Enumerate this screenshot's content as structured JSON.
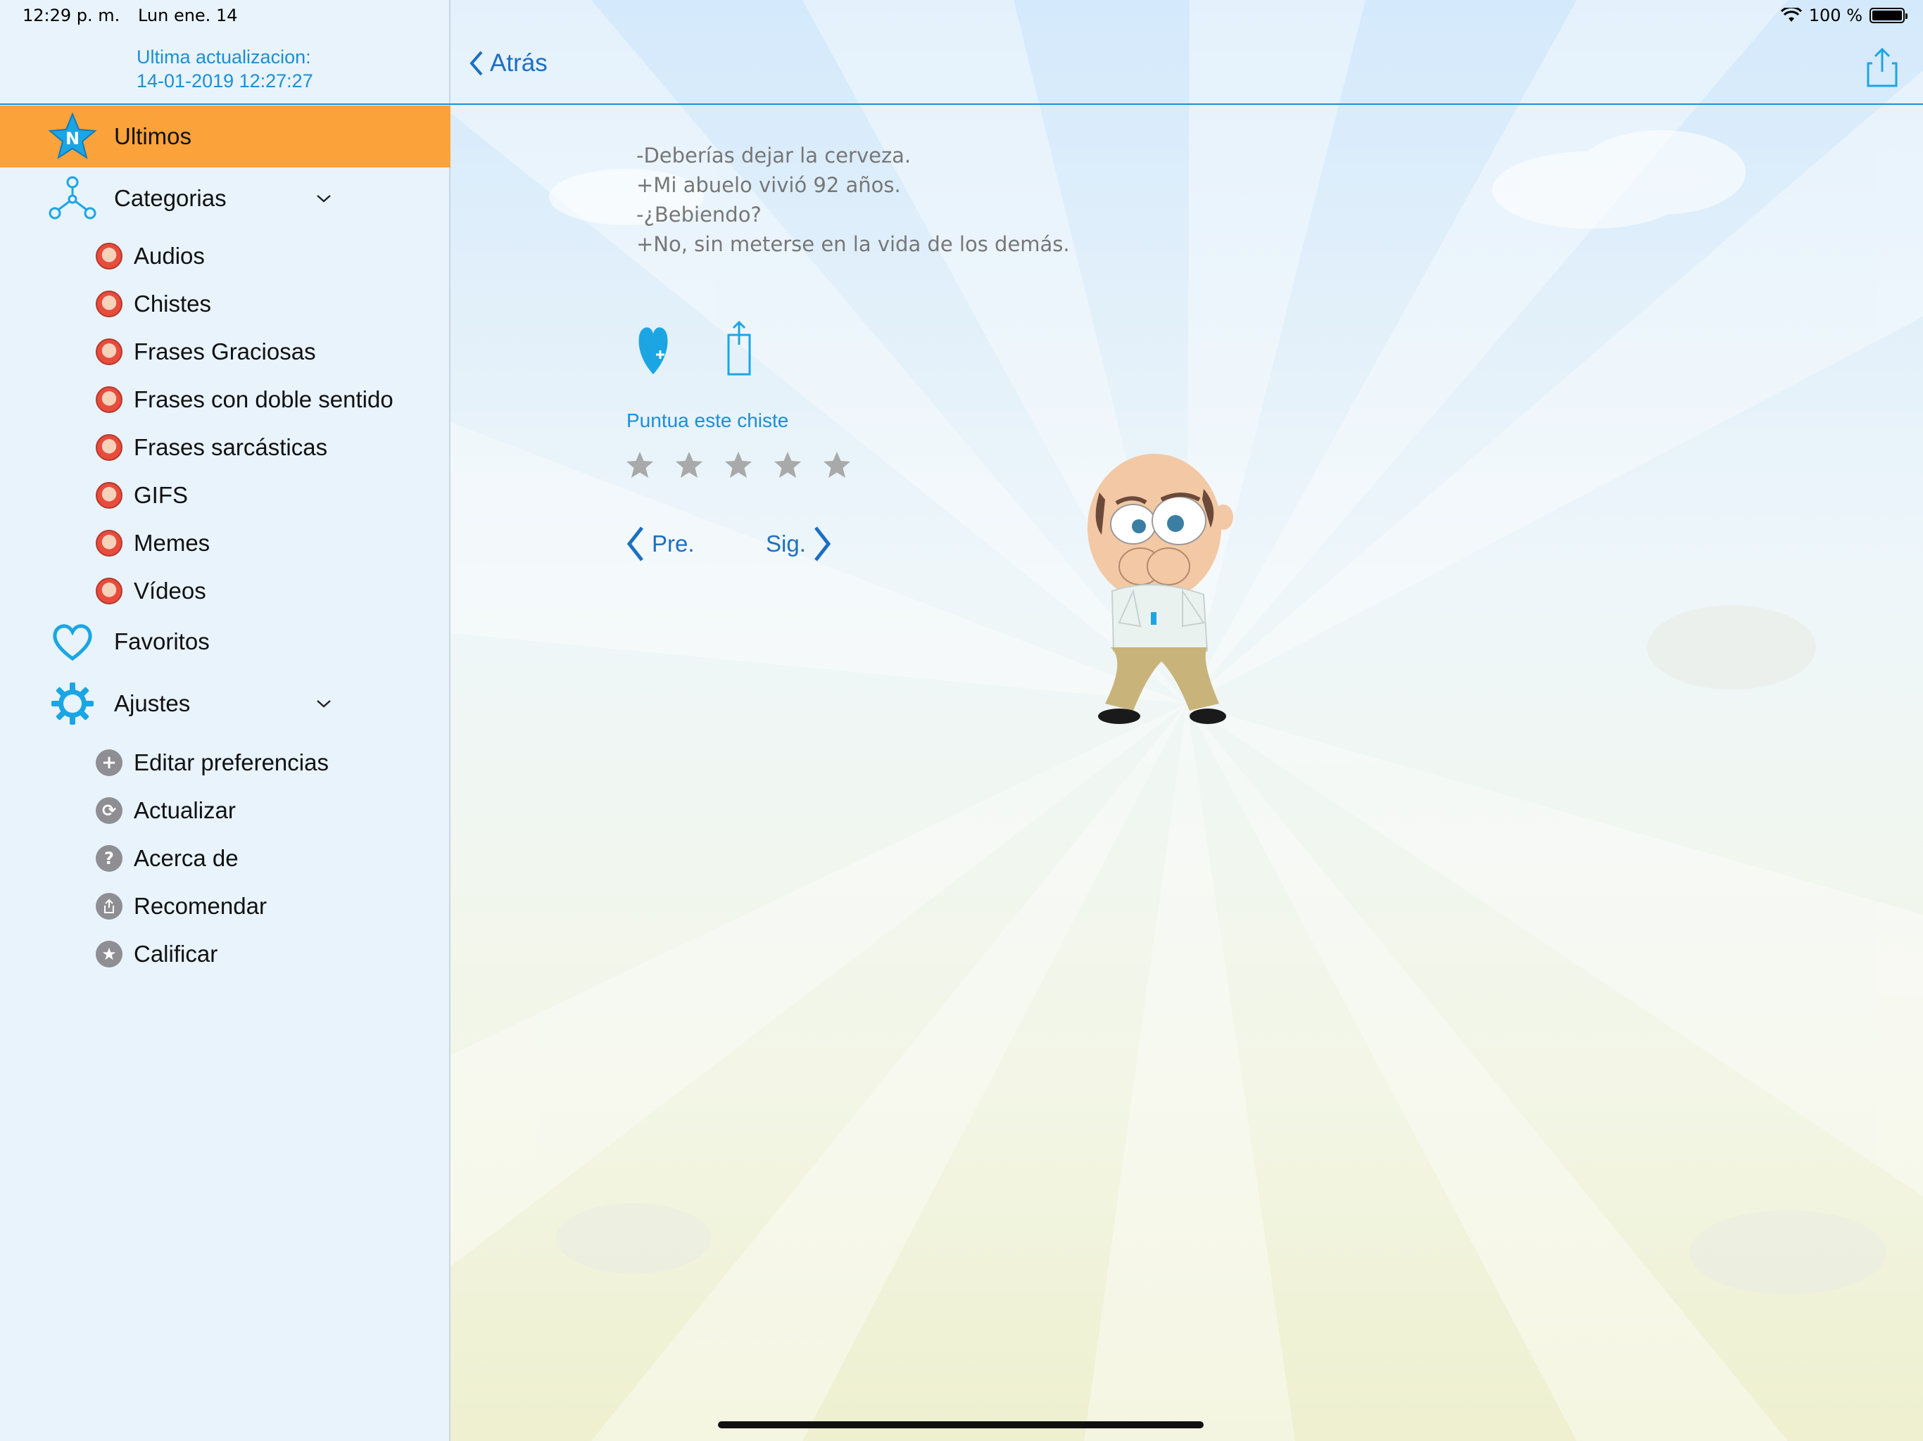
{
  "status_bar": {
    "time": "12:29 p. m.",
    "date": "Lun ene. 14",
    "battery": "100 %"
  },
  "sidebar": {
    "last_update_label": "Ultima actualizacion:",
    "last_update_value": "14-01-2019 12:27:27",
    "main_items": [
      {
        "label": "Ultimos",
        "icon": "star-n-icon",
        "active": true
      },
      {
        "label": "Categorias",
        "icon": "network-icon",
        "expanded": true
      },
      {
        "label": "Favoritos",
        "icon": "heart-icon"
      },
      {
        "label": "Ajustes",
        "icon": "gear-icon",
        "expanded": true
      }
    ],
    "categories": [
      "Audios",
      "Chistes",
      "Frases Graciosas",
      "Frases con doble sentido",
      "Frases sarcásticas",
      "GIFS",
      "Memes",
      "Vídeos"
    ],
    "settings": [
      {
        "label": "Editar preferencias",
        "icon": "plus-icon"
      },
      {
        "label": "Actualizar",
        "icon": "refresh-icon"
      },
      {
        "label": "Acerca de",
        "icon": "question-icon"
      },
      {
        "label": "Recomendar",
        "icon": "share-icon"
      },
      {
        "label": "Calificar",
        "icon": "star-icon"
      }
    ]
  },
  "nav": {
    "back_label": "Atrás"
  },
  "joke": {
    "lines": [
      "-Deberías dejar la cerveza.",
      "+Mi abuelo vivió 92 años.",
      "-¿Bebiendo?",
      "+No, sin meterse en la vida de los demás."
    ]
  },
  "rating": {
    "label": "Puntua este chiste",
    "stars_total": 5,
    "stars_filled": 0
  },
  "pager": {
    "prev_label": "Pre.",
    "next_label": "Sig."
  },
  "colors": {
    "accent": "#1b8fd6",
    "active_row": "#fba23a",
    "sidebar_bg": "#e8f3fc"
  }
}
